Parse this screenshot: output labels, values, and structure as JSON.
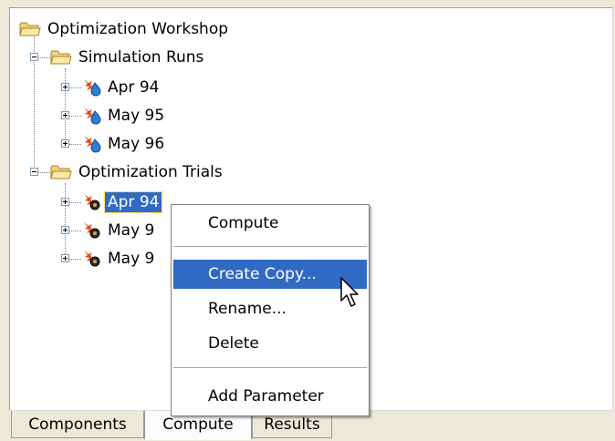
{
  "tree": {
    "root": "Optimization Workshop",
    "simulation_runs": {
      "label": "Simulation Runs",
      "items": [
        "Apr 94",
        "May 95",
        "May 96"
      ]
    },
    "optimization_trials": {
      "label": "Optimization Trials",
      "items": [
        "Apr 94",
        "May 9",
        "May 9"
      ]
    }
  },
  "context_menu": {
    "items": [
      "Compute",
      "Create Copy...",
      "Rename...",
      "Delete",
      "Add Parameter"
    ]
  },
  "tabs": [
    "Components",
    "Compute",
    "Results"
  ],
  "colors": {
    "selection": "#316ac5",
    "folder": "#f2d27a",
    "background": "#ece9d8"
  },
  "icons": {
    "folder": "folder-icon",
    "simulation_run": "simulation-run-icon",
    "optimization_trial": "optimization-trial-icon",
    "cursor": "mouse-pointer-icon"
  }
}
